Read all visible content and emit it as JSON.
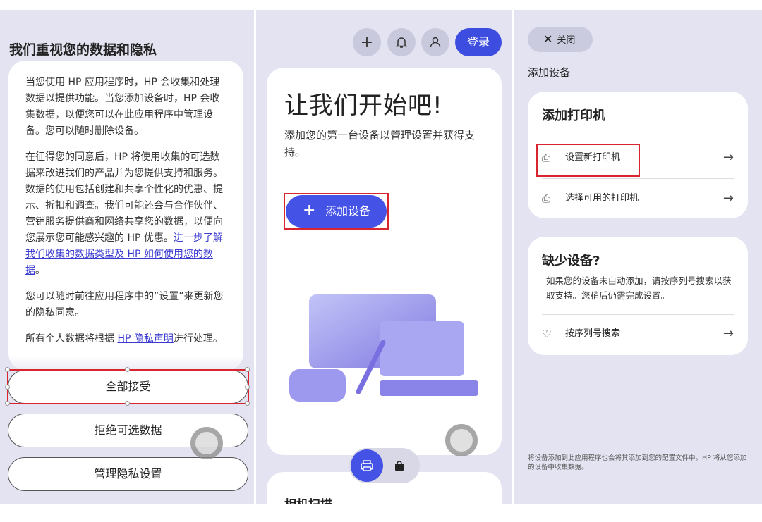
{
  "panel1": {
    "title": "我们重视您的数据和隐私",
    "para1": "当您使用 HP 应用程序时，HP 会收集和处理数据以提供功能。当您添加设备时，HP 会收集数据，以便您可以在此应用程序中管理设备。您可以随时删除设备。",
    "para2_a": "在征得您的同意后，HP 将使用收集的可选数据来改进我们的产品并为您提供支持和服务。数据的使用包括创建和共享个性化的优惠、提示、折扣和调查。我们可能还会与合作伙伴、营销服务提供商和网络共享您的数据，以便向您展示您可能感兴趣的 HP 优惠。",
    "para2_link": "进一步了解我们收集的数据类型及 HP 如何使用您的数据",
    "para2_b": "。",
    "para3": "您可以随时前往应用程序中的“设置”来更新您的隐私同意。",
    "para4_a": "所有个人数据将根据 ",
    "para4_link": "HP 隐私声明",
    "para4_b": "进行处理。",
    "accept_all": "全部接受",
    "reject": "拒绝可选数据",
    "manage": "管理隐私设置"
  },
  "panel2": {
    "login": "登录",
    "heading": "让我们开始吧!",
    "subtitle": "添加您的第一台设备以管理设置并获得支持。",
    "add_device": "添加设备",
    "next_card": "相机扫描"
  },
  "panel3": {
    "close": "关闭",
    "title": "添加设备",
    "card1_title": "添加打印机",
    "setup_new": "设置新打印机",
    "choose_available": "选择可用的打印机",
    "card2_title": "缺少设备?",
    "card2_text": "如果您的设备未自动添加，请按序列号搜索以获取支持。您稍后仍需完成设置。",
    "serial_search": "按序列号搜索",
    "footer": "将设备添加到此应用程序也会将其添加到您的配置文件中。HP 将从您添加的设备中收集数据。"
  },
  "colors": {
    "accent": "#4452e6",
    "highlight": "#d9262e",
    "bg": "#e3e3f1"
  }
}
